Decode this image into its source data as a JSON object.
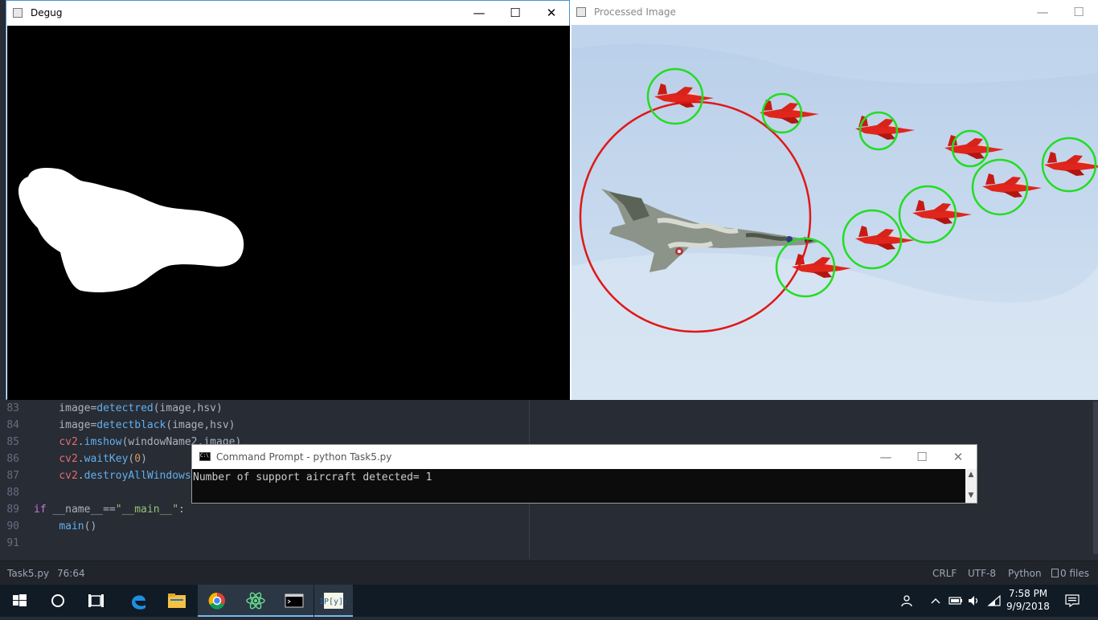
{
  "editor": {
    "lines": [
      {
        "num": "83",
        "text": "    image=detectred(image,hsv)"
      },
      {
        "num": "84",
        "text": "    image=detectblack(image,hsv)"
      },
      {
        "num": "85",
        "text": "    cv2.imshow(windowName2,image)"
      },
      {
        "num": "86",
        "text": "    cv2.waitKey(0)"
      },
      {
        "num": "87",
        "text": "    cv2.destroyAllWindows()"
      },
      {
        "num": "88",
        "text": ""
      },
      {
        "num": "89",
        "text": "if __name__==\"__main__\":"
      },
      {
        "num": "90",
        "text": "    main()"
      },
      {
        "num": "91",
        "text": ""
      }
    ]
  },
  "status_bar": {
    "file": "Task5.py",
    "cursor": "76:64",
    "line_ending": "CRLF",
    "encoding": "UTF-8",
    "language": "Python",
    "files": "0 files"
  },
  "debug_window": {
    "title": "Degug",
    "minimize": "—",
    "maximize": "☐",
    "close": "✕"
  },
  "processed_window": {
    "title": "Processed Image",
    "minimize": "—",
    "maximize": "☐"
  },
  "cmd_window": {
    "title": "Command Prompt - python  Task5.py",
    "output": "Number of support aircraft detected= 1",
    "minimize": "—",
    "maximize": "☐",
    "close": "✕",
    "scroll_up": "▲",
    "scroll_down": "▼"
  },
  "taskbar": {
    "time": "7:58 PM",
    "date": "9/9/2018",
    "icons": [
      "windows-start-icon",
      "cortana-circle-icon",
      "task-view-icon",
      "edge-icon",
      "file-explorer-icon",
      "chrome-icon",
      "atom-icon",
      "cmd-icon",
      "python-idle-icon"
    ],
    "tray_icons": [
      "people-icon",
      "chevron-up-icon",
      "battery-icon",
      "volume-icon",
      "wifi-icon",
      "action-center-icon"
    ]
  },
  "colors": {
    "editor_bg": "#282c34",
    "detect_red": "#e01818",
    "detect_green": "#22dd22",
    "sky": "#c9dbef",
    "taskbar": "#101b26"
  }
}
